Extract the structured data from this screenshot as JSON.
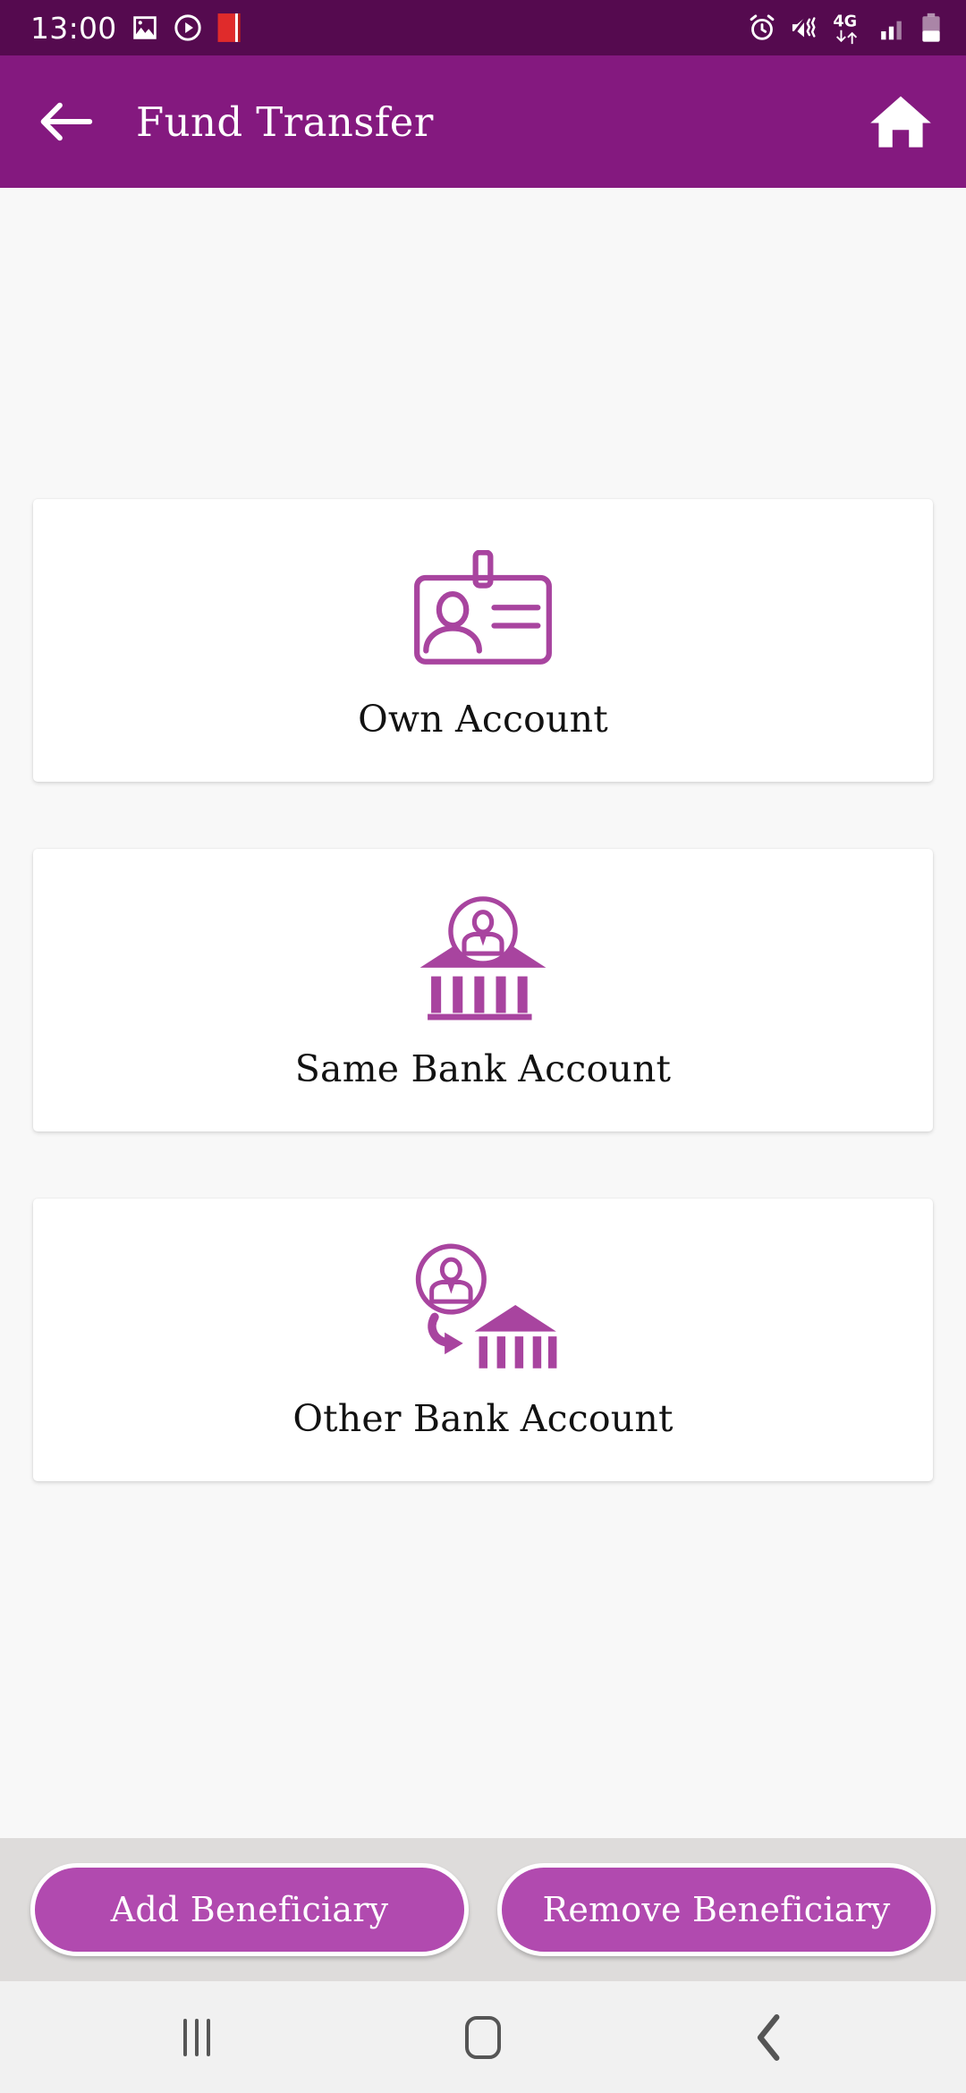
{
  "status_bar": {
    "time": "13:00",
    "left_icons": [
      "gallery-icon",
      "recording-circle-icon",
      "red-book-icon"
    ],
    "right_icons": [
      "alarm-icon",
      "mute-vibrate-icon",
      "network-4g-icon",
      "signal-bars-icon",
      "battery-icon"
    ],
    "network_label": "4G",
    "background_color": "#550a4f"
  },
  "app_bar": {
    "back_label": "back-arrow",
    "title": "Fund Transfer",
    "home_label": "home",
    "background_color": "#84197f"
  },
  "main": {
    "options": [
      {
        "label": "Own Account",
        "icon": "id-badge-icon"
      },
      {
        "label": "Same Bank Account",
        "icon": "bank-with-person-icon"
      },
      {
        "label": "Other Bank Account",
        "icon": "transfer-to-bank-icon"
      }
    ],
    "background_color": "#f8f8f8",
    "card_color": "#ffffff"
  },
  "button_bar": {
    "add_beneficiary_label": "Add Beneficiary",
    "remove_beneficiary_label": "Remove Beneficiary",
    "background_color": "#dedcdb",
    "button_color": "#b14aaf"
  },
  "nav_bar": {
    "recents_label": "recents",
    "home_label": "home",
    "back_label": "back",
    "background_color": "#f1f1f1"
  },
  "theme": {
    "primary": "#84197f",
    "status_dark": "#550a4f",
    "accent": "#b14aaf",
    "icon_purple": "#a8449f"
  }
}
